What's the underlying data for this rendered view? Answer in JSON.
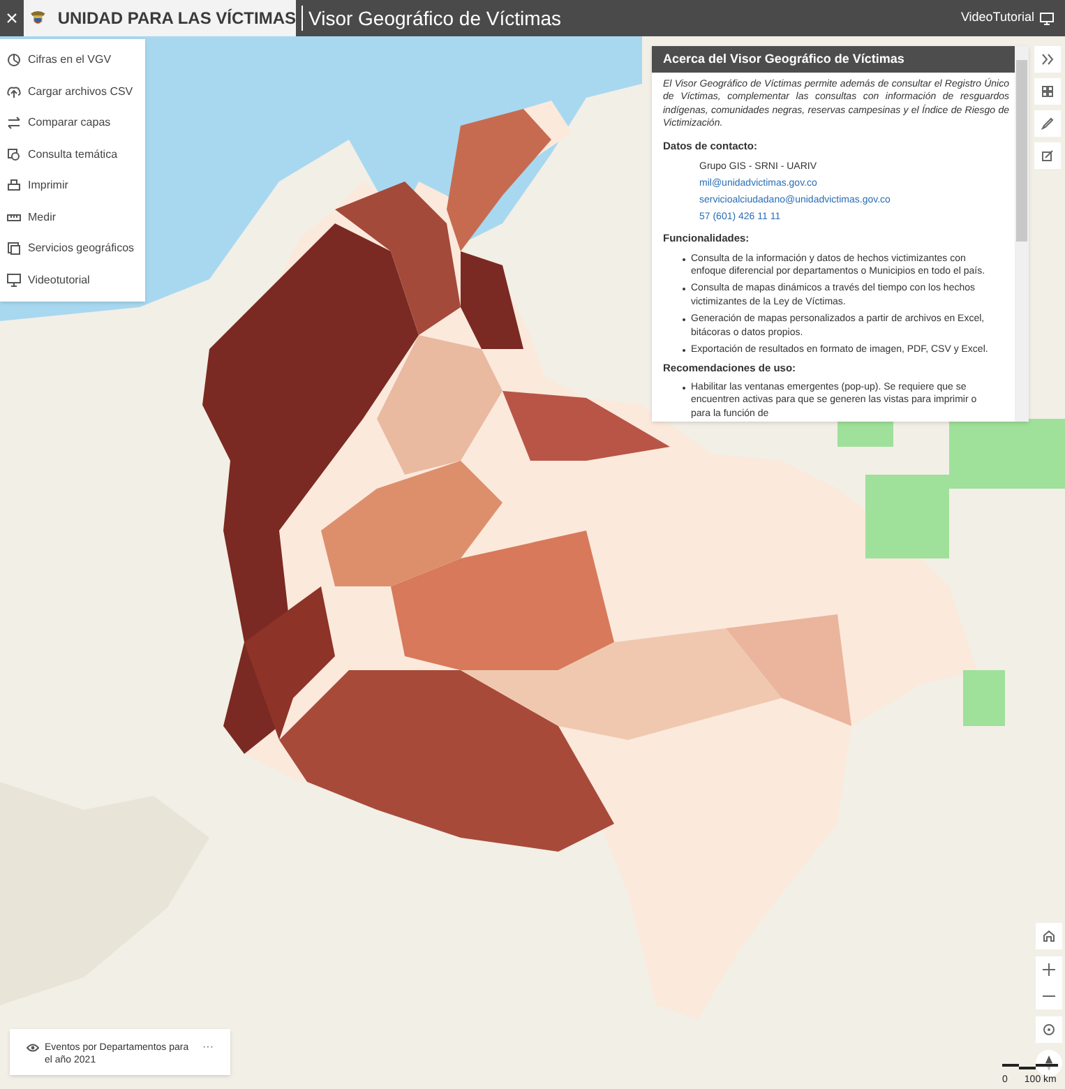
{
  "header": {
    "close": "×",
    "org_name": "UNIDAD PARA LAS VÍCTIMAS",
    "title": "Visor Geográfico de Víctimas",
    "videotutorial": "VideoTutorial"
  },
  "menu": [
    {
      "label": "Cifras en el VGV",
      "kind": "chart"
    },
    {
      "label": "Cargar archivos CSV",
      "kind": "upload"
    },
    {
      "label": "Comparar capas",
      "kind": "swap"
    },
    {
      "label": "Consulta temática",
      "kind": "query"
    },
    {
      "label": "Imprimir",
      "kind": "print"
    },
    {
      "label": "Medir",
      "kind": "ruler"
    },
    {
      "label": "Servicios geográficos",
      "kind": "layers"
    },
    {
      "label": "Videotutorial",
      "kind": "monitor"
    }
  ],
  "info_panel": {
    "title": "Acerca del Visor Geográfico de Víctimas",
    "intro": "El Visor Geográfico de Víctimas permite además de consultar el Registro Único de Víctimas, complementar las consultas con información de resguardos indígenas, comunidades negras, reservas campesinas y el Índice de Riesgo de Victimización.",
    "contact_heading": "Datos de contacto:",
    "contacts": [
      {
        "text": "Grupo GIS - SRNI - UARIV",
        "kind": "text"
      },
      {
        "text": "mil@unidadvictimas.gov.co",
        "kind": "link"
      },
      {
        "text": "servicioalciudadano@unidadvictimas.gov.co",
        "kind": "link"
      },
      {
        "text": "57 (601) 426 11 11",
        "kind": "link"
      }
    ],
    "features_heading": "Funcionalidades:",
    "features": [
      "Consulta de la información y datos de hechos victimizantes con enfoque diferencial por departamentos o Municipios en todo el país.",
      "Consulta de mapas dinámicos a través del tiempo con los hechos victimizantes de la Ley de Víctimas.",
      "Generación de mapas personalizados a partir de archivos en Excel, bitácoras o datos propios.",
      "Exportación de resultados en formato de imagen, PDF, CSV y Excel."
    ],
    "recommendations_heading": "Recomendaciones de uso:",
    "recommendations": [
      "Habilitar las ventanas emergentes (pop-up). Se requiere que se encuentren activas para que se generen las vistas para imprimir o para la función de"
    ]
  },
  "toolbar": [
    {
      "kind": "collapse"
    },
    {
      "kind": "grid"
    },
    {
      "kind": "pencil"
    },
    {
      "kind": "edit"
    }
  ],
  "legend": {
    "label": "Eventos por Departamentos para el año 2021",
    "more": "···"
  },
  "scale": {
    "zero": "0",
    "distance": "100 km"
  }
}
